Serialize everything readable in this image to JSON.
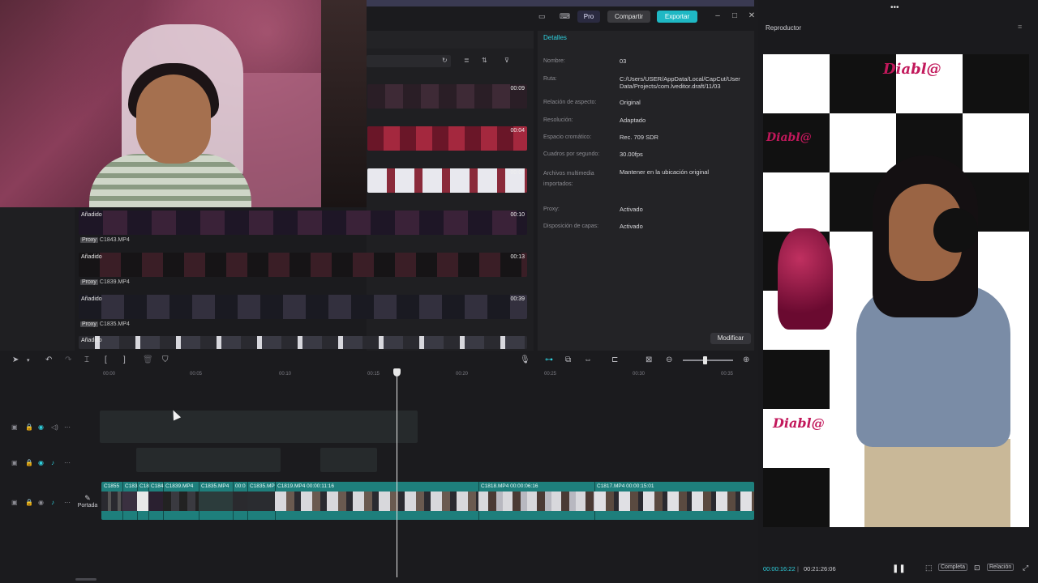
{
  "topbar": {
    "pro_label": "Pro",
    "share_label": "Compartir",
    "export_label": "Exportar"
  },
  "media": {
    "clips": [
      {
        "duration": "00:09"
      },
      {
        "duration": "00:04"
      },
      {
        "duration": "00:07"
      },
      {
        "status": "Añadido",
        "duration": "00:10",
        "proxy_tag": "Proxy",
        "filename": "C1843.MP4"
      },
      {
        "status": "Añadido",
        "duration": "00:13",
        "proxy_tag": "Proxy",
        "filename": "C1839.MP4"
      },
      {
        "status": "Añadido",
        "duration": "00:39",
        "proxy_tag": "Proxy",
        "filename": "C1835.MP4"
      },
      {
        "status": "Añadido",
        "duration": "",
        "proxy_tag": "",
        "filename": ""
      }
    ]
  },
  "details": {
    "title": "Detalles",
    "rows": [
      {
        "label": "Nombre:",
        "value": "03"
      },
      {
        "label": "Ruta:",
        "value": "C:/Users/USER/AppData/Local/CapCut/User Data/Projects/com.lveditor.draft/11/03"
      },
      {
        "label": "Relación de aspecto:",
        "value": "Original"
      },
      {
        "label": "Resolución:",
        "value": "Adaptado"
      },
      {
        "label": "Espacio cromático:",
        "value": "Rec. 709 SDR"
      },
      {
        "label": "Cuadros por segundo:",
        "value": "30.00fps"
      },
      {
        "label": "Archivos multimedia importados:",
        "value": "Mantener en la ubicación original"
      },
      {
        "label": "Proxy:",
        "value": "Activado"
      },
      {
        "label": "Disposición de capas:",
        "value": "Activado"
      }
    ],
    "modify_label": "Modificar"
  },
  "player": {
    "title": "Reproductor",
    "current_time": "00:00:16:22",
    "total_time": "00:21:26:06",
    "fullscreen_label": "Completa",
    "ratio_label": "Relación",
    "logo_text": "Diabl@"
  },
  "timeline": {
    "ruler": [
      "00:00",
      "00:05",
      "00:10",
      "00:15",
      "00:20",
      "00:25",
      "00:30",
      "00:35"
    ],
    "cover_label": "Portada",
    "segments": [
      {
        "label": "C1855"
      },
      {
        "label": "C183"
      },
      {
        "label": "C18"
      },
      {
        "label": "C184"
      },
      {
        "label": "C1839.MP4"
      },
      {
        "label": "C1835.MP4"
      },
      {
        "label": "00:0"
      },
      {
        "label": "C1835.MP"
      },
      {
        "label": "C1819.MP4   00:00:11:16"
      },
      {
        "label": "C1818.MP4   00:00:06:16"
      },
      {
        "label": "C1817.MP4   00:00:15:01"
      }
    ]
  },
  "colors": {
    "accent": "#1fb8c4",
    "track": "#1e7f7c",
    "brand_logo": "#c2185b"
  }
}
